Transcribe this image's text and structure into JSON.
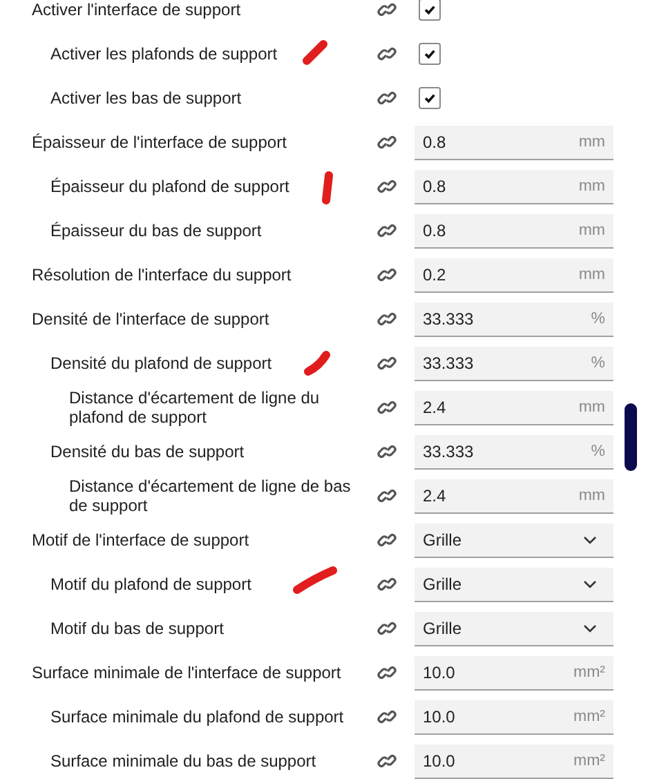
{
  "settings": [
    {
      "label": "Activer l'interface de support",
      "kind": "checkbox",
      "checked": true,
      "children": [
        {
          "label": "Activer les plafonds de support",
          "kind": "checkbox",
          "checked": true
        },
        {
          "label": "Activer les bas de support",
          "kind": "checkbox",
          "checked": true
        }
      ]
    },
    {
      "label": "Épaisseur de l'interface de support",
      "kind": "number",
      "value": "0.8",
      "unit": "mm",
      "children": [
        {
          "label": "Épaisseur du plafond de support",
          "kind": "number",
          "value": "0.8",
          "unit": "mm"
        },
        {
          "label": "Épaisseur du bas de support",
          "kind": "number",
          "value": "0.8",
          "unit": "mm"
        }
      ]
    },
    {
      "label": "Résolution de l'interface du support",
      "kind": "number",
      "value": "0.2",
      "unit": "mm"
    },
    {
      "label": "Densité de l'interface de support",
      "kind": "number",
      "value": "33.333",
      "unit": "%",
      "children": [
        {
          "label": "Densité du plafond de support",
          "kind": "number",
          "value": "33.333",
          "unit": "%",
          "children": [
            {
              "label": "Distance d'écartement de ligne du plafond de support",
              "kind": "number",
              "value": "2.4",
              "unit": "mm"
            }
          ]
        },
        {
          "label": "Densité du bas de support",
          "kind": "number",
          "value": "33.333",
          "unit": "%",
          "children": [
            {
              "label": "Distance d'écartement de ligne de bas de support",
              "kind": "number",
              "value": "2.4",
              "unit": "mm"
            }
          ]
        }
      ]
    },
    {
      "label": "Motif de l'interface de support",
      "kind": "dropdown",
      "value": "Grille",
      "children": [
        {
          "label": "Motif du plafond de support",
          "kind": "dropdown",
          "value": "Grille"
        },
        {
          "label": "Motif du bas de support",
          "kind": "dropdown",
          "value": "Grille"
        }
      ]
    },
    {
      "label": "Surface minimale de l'interface de support",
      "kind": "number",
      "value": "10.0",
      "unit": "mm²",
      "children": [
        {
          "label": "Surface minimale du plafond de support",
          "kind": "number",
          "value": "10.0",
          "unit": "mm²"
        },
        {
          "label": "Surface minimale du bas de support",
          "kind": "number",
          "value": "10.0",
          "unit": "mm²"
        }
      ]
    }
  ]
}
